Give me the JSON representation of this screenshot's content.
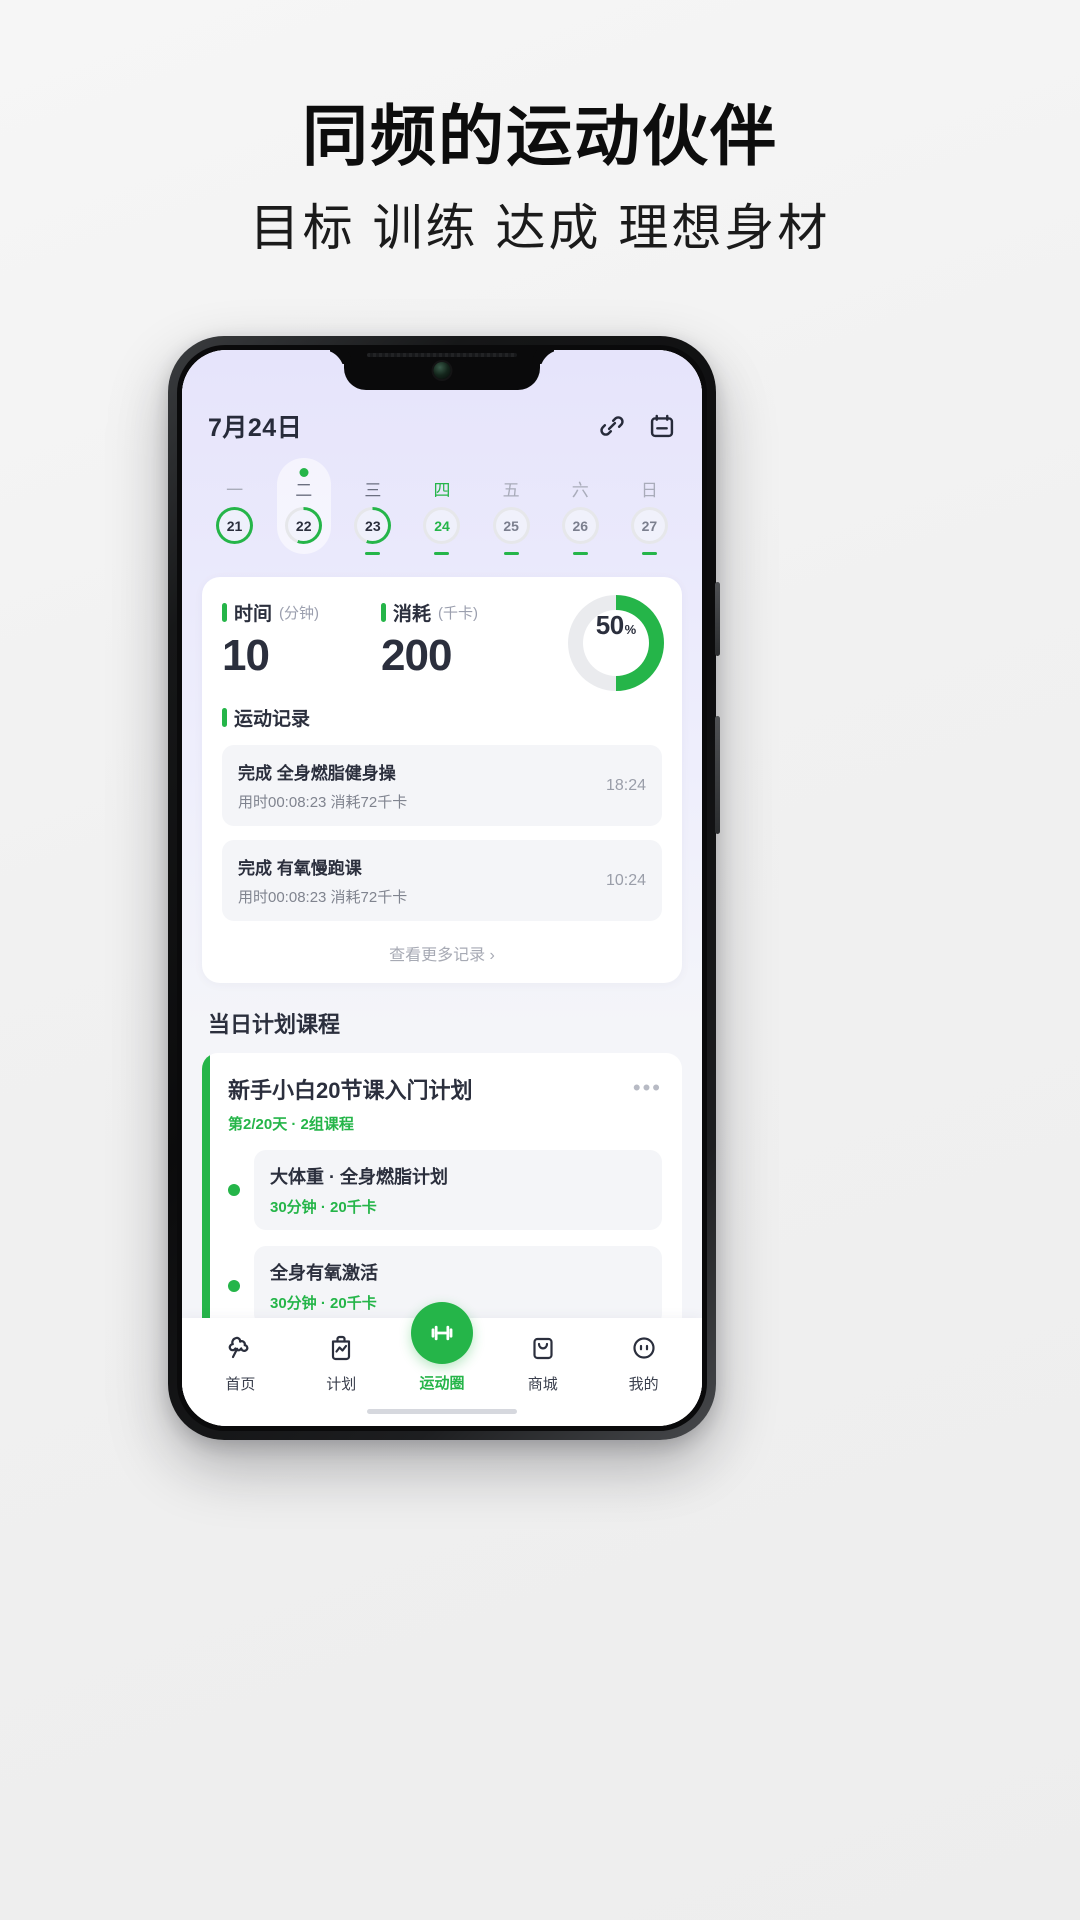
{
  "promo": {
    "title": "同频的运动伙伴",
    "subtitle": "目标 训练 达成 理想身材"
  },
  "app": {
    "header": {
      "date": "7月24日",
      "link_icon": "link-icon",
      "calendar_icon": "calendar-icon"
    },
    "week": {
      "days": [
        {
          "weekday": "一",
          "date": "21",
          "progress": 100,
          "state": "past",
          "underline": false,
          "selected": false,
          "dot": false
        },
        {
          "weekday": "二",
          "date": "22",
          "progress": 55,
          "state": "past",
          "underline": false,
          "selected": true,
          "dot": true
        },
        {
          "weekday": "三",
          "date": "23",
          "progress": 55,
          "state": "past",
          "underline": true,
          "selected": false,
          "dot": false
        },
        {
          "weekday": "四",
          "date": "24",
          "progress": 0,
          "state": "today",
          "underline": true,
          "selected": false,
          "dot": false
        },
        {
          "weekday": "五",
          "date": "25",
          "progress": 0,
          "state": "future",
          "underline": true,
          "selected": false,
          "dot": false
        },
        {
          "weekday": "六",
          "date": "26",
          "progress": 0,
          "state": "future",
          "underline": true,
          "selected": false,
          "dot": false
        },
        {
          "weekday": "日",
          "date": "27",
          "progress": 0,
          "state": "future",
          "underline": true,
          "selected": false,
          "dot": false
        }
      ]
    },
    "summary": {
      "time_label": "时间",
      "time_unit": "(分钟)",
      "time_value": "10",
      "calorie_label": "消耗",
      "calorie_unit": "(千卡)",
      "calorie_value": "200",
      "progress_value": "50",
      "progress_symbol": "%",
      "progress_percent": 50
    },
    "records": {
      "section_title": "运动记录",
      "items": [
        {
          "title": "完成 全身燃脂健身操",
          "detail": "用时00:08:23 消耗72千卡",
          "time": "18:24"
        },
        {
          "title": "完成 有氧慢跑课",
          "detail": "用时00:08:23 消耗72千卡",
          "time": "10:24"
        }
      ],
      "more_label": "查看更多记录 ›"
    },
    "plan": {
      "section_title": "当日计划课程",
      "title": "新手小白20节课入门计划",
      "meta": "第2/20天 · 2组课程",
      "menu_icon": "more-dots-icon",
      "lessons": [
        {
          "name": "大体重 · 全身燃脂计划",
          "detail": "30分钟 · 20千卡"
        },
        {
          "name": "全身有氧激活",
          "detail": "30分钟 · 20千卡"
        }
      ]
    },
    "tabbar": {
      "items": [
        {
          "label": "首页",
          "icon": "home-icon",
          "active": false
        },
        {
          "label": "计划",
          "icon": "plan-icon",
          "active": false
        },
        {
          "label": "运动圈",
          "icon": "fitness-icon",
          "active": true
        },
        {
          "label": "商城",
          "icon": "shop-icon",
          "active": false
        },
        {
          "label": "我的",
          "icon": "profile-icon",
          "active": false
        }
      ]
    }
  },
  "colors": {
    "accent_green": "#25b549",
    "text_dark": "#2b2f3d",
    "text_muted": "#9a9ea9",
    "screen_bg": "#f4f5f9"
  }
}
